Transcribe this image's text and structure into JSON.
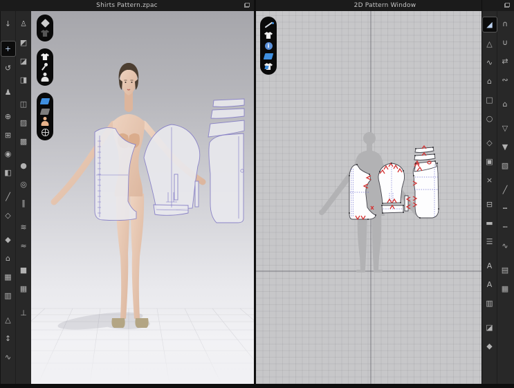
{
  "window": {
    "left_title": "Shirts Pattern.zpac",
    "right_title": "2D Pattern Window"
  },
  "colors": {
    "selection_blue": "#4a90d9",
    "notch_red": "#d43030",
    "pattern_outline_purple": "#8a83c7",
    "pattern_internal_blue": "#5c5ccc",
    "fabric_blue": "#3f8fe0",
    "skin_tone": "#e8b48c",
    "toolbar_bg": "#282828",
    "viewport2d_bg": "#c7c7c9"
  },
  "left_toolbar": {
    "column1": [
      {
        "n": "simulate-icon",
        "g": "↓"
      },
      {
        "n": "select-move-icon",
        "g": "+",
        "sel": true,
        "gap": true
      },
      {
        "n": "select-lasso-icon",
        "g": "↺"
      },
      {
        "n": "move-avatar-icon",
        "g": "♟",
        "gap": true
      },
      {
        "n": "pin-tool-icon",
        "g": "⊕",
        "gap": true
      },
      {
        "n": "pin-box-icon",
        "g": "⊞"
      },
      {
        "n": "attach-pins-icon",
        "g": "◉"
      },
      {
        "n": "fold-arrangement-icon",
        "g": "◧"
      },
      {
        "n": "sewing-needle-icon",
        "g": "╱",
        "gap": true
      },
      {
        "n": "tack-dart-icon",
        "g": "◇"
      },
      {
        "n": "grasp-tool-icon",
        "g": "◆",
        "gap": true
      },
      {
        "n": "arrangement-cap-icon",
        "g": "⌂"
      },
      {
        "n": "shirt-pair-icon",
        "g": "▦"
      },
      {
        "n": "pants-arrange-icon",
        "g": "▥"
      },
      {
        "n": "flatten-garment-icon",
        "g": "△",
        "gap": true
      },
      {
        "n": "measure-avatar-icon",
        "g": "↕"
      },
      {
        "n": "curve-measure-icon",
        "g": "∿"
      }
    ],
    "column2": [
      {
        "n": "pose-avatar-icon",
        "g": "♙"
      },
      {
        "n": "arrange-point-icon",
        "g": "◩"
      },
      {
        "n": "arrange-curve-icon",
        "g": "◪"
      },
      {
        "n": "arrange-board-icon",
        "g": "◨"
      },
      {
        "n": "attach-to-avatar-icon",
        "g": "◫",
        "gap": true
      },
      {
        "n": "mesh-garment-icon",
        "g": "▨"
      },
      {
        "n": "textured-garment-icon",
        "g": "▩"
      },
      {
        "n": "button-icon",
        "g": "●",
        "gap": true
      },
      {
        "n": "buttonhole-icon",
        "g": "◎"
      },
      {
        "n": "zipper-icon",
        "g": "‖"
      },
      {
        "n": "topstitch-icon",
        "g": "≋",
        "gap": true
      },
      {
        "n": "shirring-icon",
        "g": "≈"
      },
      {
        "n": "solidify-freeze-icon",
        "g": "■",
        "gap": true
      },
      {
        "n": "solidify-box-icon",
        "g": "▦"
      },
      {
        "n": "avatar-connector-icon",
        "g": "⊥",
        "gap": true
      }
    ]
  },
  "right_toolbar": {
    "column1": [
      {
        "n": "transform-pattern-icon",
        "g": "◢",
        "c": "#4a90d9",
        "sel": true
      },
      {
        "n": "edit-pattern-icon",
        "g": "△"
      },
      {
        "n": "edit-curvature-icon",
        "g": "∿"
      },
      {
        "n": "polygon-pattern-icon",
        "g": "⌂"
      },
      {
        "n": "rectangle-pattern-icon",
        "g": "□"
      },
      {
        "n": "circle-pattern-icon",
        "g": "○"
      },
      {
        "n": "dart-icon",
        "g": "◇",
        "gap": true
      },
      {
        "n": "trace-pattern-icon",
        "g": "▣"
      },
      {
        "n": "cut-sew-icon",
        "g": "×"
      },
      {
        "n": "seam-allowance-icon",
        "g": "⊟",
        "gap": true
      },
      {
        "n": "internal-line-icon",
        "g": "▬"
      },
      {
        "n": "baseline-icon",
        "g": "☰"
      },
      {
        "n": "pattern-annotation-icon",
        "g": "A",
        "gap": true
      },
      {
        "n": "pattern-text-icon",
        "g": "A"
      },
      {
        "n": "pleat-icon",
        "g": "▥"
      },
      {
        "n": "fabric-tool-icon",
        "g": "◪",
        "gap": true
      },
      {
        "n": "pin-tack-icon",
        "g": "◆"
      }
    ],
    "column2": [
      {
        "n": "segment-sewing-icon",
        "g": "∩"
      },
      {
        "n": "free-sewing-icon",
        "g": "∪"
      },
      {
        "n": "mn-sewing-icon",
        "g": "⇄"
      },
      {
        "n": "edit-sewing-icon",
        "g": "∾"
      },
      {
        "n": "fuse-iron-icon",
        "g": "⌂",
        "gap": true
      },
      {
        "n": "fold-garment-icon",
        "g": "▽",
        "gap": true
      },
      {
        "n": "pin-garment-icon",
        "g": "▼"
      },
      {
        "n": "texture-garment-icon",
        "g": "▧"
      },
      {
        "n": "stitch-slash-icon",
        "g": "╱",
        "gap": true
      },
      {
        "n": "seam-dash-icon",
        "g": "┅"
      },
      {
        "n": "elastic-icon",
        "g": "┉"
      },
      {
        "n": "shirring-line-icon",
        "g": "∿"
      },
      {
        "n": "grading-icon",
        "g": "▤",
        "gap": true
      },
      {
        "n": "grading-table-icon",
        "g": "▦"
      }
    ]
  },
  "viewport3d": {
    "group1": [
      {
        "n": "show-garment-icon",
        "shape": "diamond",
        "c": "#cccccc"
      },
      {
        "n": "show-pattern-icon",
        "shape": "shirt",
        "c": "#555555"
      }
    ],
    "group2": [
      {
        "n": "show-shirt-icon",
        "shape": "shirt",
        "c": "#f2f2f2"
      },
      {
        "n": "show-pins-icon",
        "shape": "pin",
        "c": "#e8e8e8"
      },
      {
        "n": "show-avatar-icon",
        "shape": "person",
        "c": "#e6e6e6"
      }
    ],
    "group3": [
      {
        "n": "fabric-front-icon",
        "shape": "fabric",
        "c": "#3f8fe0"
      },
      {
        "n": "fabric-back-icon",
        "shape": "fabric",
        "c": "#7d7d7d"
      },
      {
        "n": "show-skin-icon",
        "shape": "person",
        "c": "#e8b48c"
      },
      {
        "n": "show-world-icon",
        "shape": "globe",
        "c": "#cfcfcf"
      }
    ]
  },
  "viewport2d": {
    "tools": [
      {
        "n": "edit-line-icon",
        "shape": "pen",
        "c": "#d7dde4"
      },
      {
        "n": "show-pattern-shirt-icon",
        "shape": "shirt",
        "c": "#f2f2f2"
      },
      {
        "n": "pattern-info-icon",
        "shape": "info",
        "c": "#5a8fd8"
      },
      {
        "n": "fabric-view-icon",
        "shape": "fabric",
        "c": "#3f8fe0"
      },
      {
        "n": "texture-shirt-icon",
        "shape": "shirt2",
        "c": "#f2f2f2"
      }
    ]
  }
}
